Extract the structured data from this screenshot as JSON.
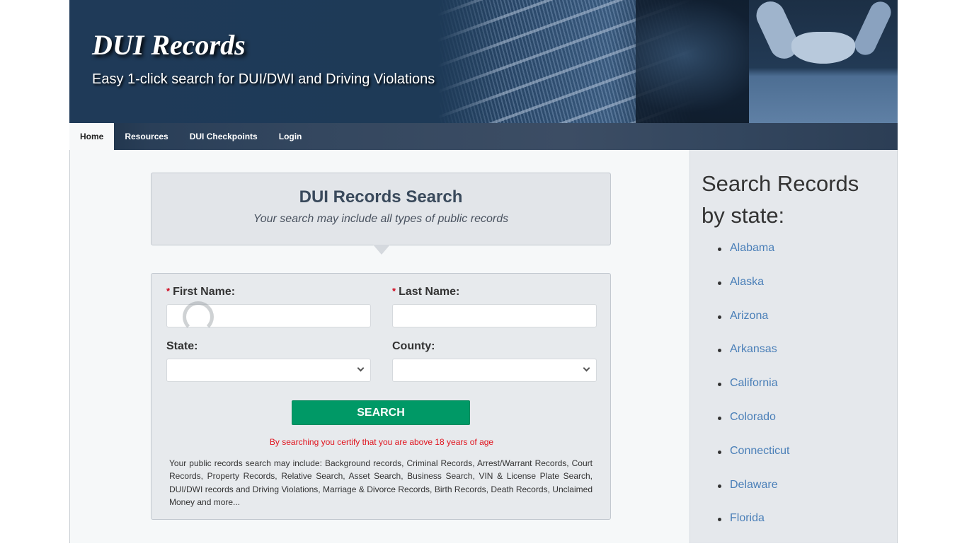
{
  "header": {
    "site_title": "DUI Records",
    "tagline": "Easy 1-click search for DUI/DWI and Driving Violations"
  },
  "nav": {
    "items": [
      {
        "label": "Home",
        "active": true
      },
      {
        "label": "Resources",
        "active": false
      },
      {
        "label": "DUI Checkpoints",
        "active": false
      },
      {
        "label": "Login",
        "active": false
      }
    ]
  },
  "search": {
    "title": "DUI Records Search",
    "subtitle": "Your search may include all types of public records",
    "required_marker": "*",
    "first_name": {
      "label": "First Name:",
      "value": "",
      "placeholder": ""
    },
    "last_name": {
      "label": "Last Name:",
      "value": "",
      "placeholder": ""
    },
    "state": {
      "label": "State:",
      "selected": ""
    },
    "county": {
      "label": "County:",
      "selected": ""
    },
    "button_label": "SEARCH",
    "age_notice": "By searching you certify that you are above 18 years of age",
    "includes_text": "Your public records search may include: Background records, Criminal Records, Arrest/Warrant Records, Court Records, Property Records, Relative Search, Asset Search, Business Search, VIN & License Plate Search, DUI/DWI records and Driving Violations, Marriage & Divorce Records, Birth Records, Death Records, Unclaimed Money and more..."
  },
  "sidebar": {
    "title": "Search Records by state:",
    "states": [
      "Alabama",
      "Alaska",
      "Arizona",
      "Arkansas",
      "California",
      "Colorado",
      "Connecticut",
      "Delaware",
      "Florida"
    ]
  },
  "colors": {
    "header_bg": "#1f3a58",
    "search_button": "#009966",
    "age_notice": "#e0141e",
    "link": "#4a7fb8",
    "required": "#d0021b"
  }
}
